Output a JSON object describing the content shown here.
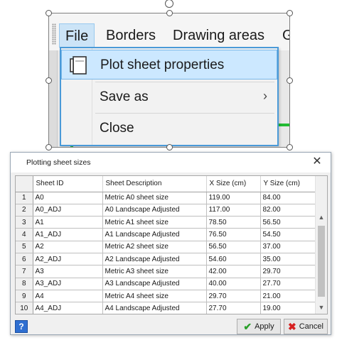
{
  "menu": {
    "bar_items": [
      "File",
      "Borders",
      "Drawing areas",
      "G"
    ],
    "dropdown": {
      "items": [
        {
          "label": "Plot sheet properties",
          "highlighted": true,
          "icon": "page-properties-icon"
        },
        {
          "label": "Save as",
          "submenu_arrow": "›"
        },
        {
          "label": "Close"
        }
      ]
    }
  },
  "dialog": {
    "title": "Plotting sheet sizes",
    "close_glyph": "✕",
    "columns": [
      "",
      "Sheet ID",
      "Sheet Description",
      "X Size (cm)",
      "Y Size (cm)"
    ],
    "rows": [
      {
        "n": "1",
        "id": "A0",
        "desc": "Metric A0 sheet size",
        "x": "119.00",
        "y": "84.00"
      },
      {
        "n": "2",
        "id": "A0_ADJ",
        "desc": "A0 Landscape Adjusted",
        "x": "117.00",
        "y": "82.00"
      },
      {
        "n": "3",
        "id": "A1",
        "desc": "Metric A1 sheet size",
        "x": "78.50",
        "y": "56.50"
      },
      {
        "n": "4",
        "id": "A1_ADJ",
        "desc": "A1 Landscape Adjusted",
        "x": "76.50",
        "y": "54.50"
      },
      {
        "n": "5",
        "id": "A2",
        "desc": "Metric A2 sheet size",
        "x": "56.50",
        "y": "37.00"
      },
      {
        "n": "6",
        "id": "A2_ADJ",
        "desc": "A2 Landscape Adjusted",
        "x": "54.60",
        "y": "35.00"
      },
      {
        "n": "7",
        "id": "A3",
        "desc": "Metric A3 sheet size",
        "x": "42.00",
        "y": "29.70"
      },
      {
        "n": "8",
        "id": "A3_ADJ",
        "desc": "A3 Landscape Adjusted",
        "x": "40.00",
        "y": "27.70"
      },
      {
        "n": "9",
        "id": "A4",
        "desc": "Metric A4 sheet size",
        "x": "29.70",
        "y": "21.00"
      },
      {
        "n": "10",
        "id": "A4_ADJ",
        "desc": "A4 Landscape Adjusted",
        "x": "27.70",
        "y": "19.00"
      }
    ],
    "help_label": "?",
    "apply_label": "Apply",
    "cancel_label": "Cancel",
    "colors": {
      "accent": "#4a9ad8",
      "highlight": "#cce8ff",
      "apply_check": "#2aa02a",
      "cancel_x": "#d62020"
    }
  }
}
